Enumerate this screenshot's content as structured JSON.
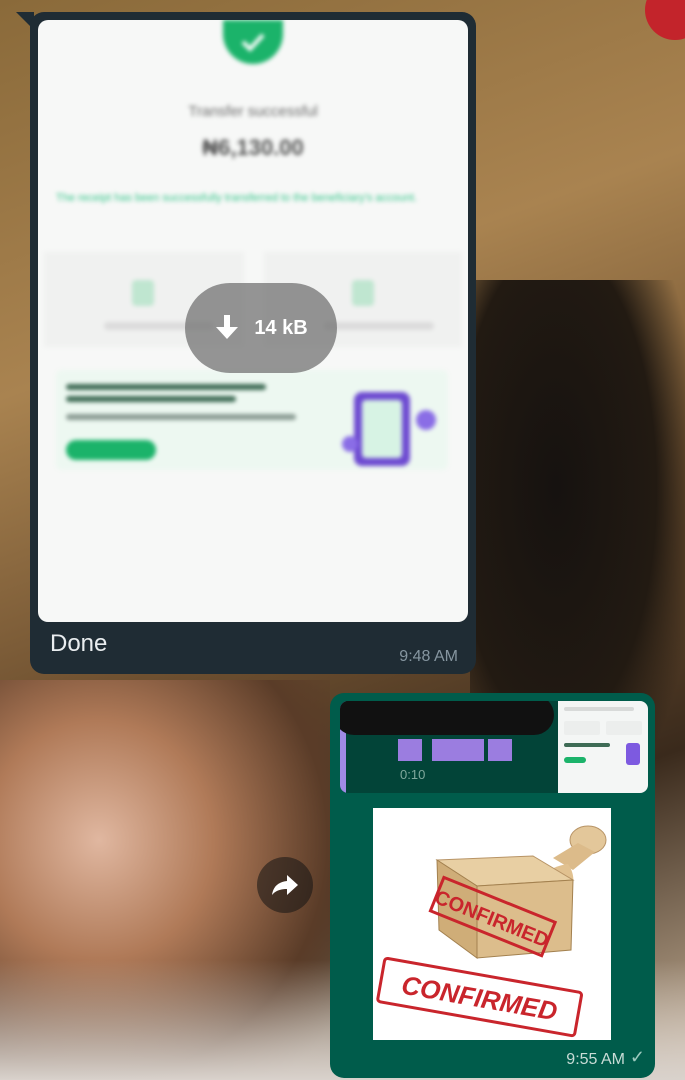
{
  "incoming": {
    "receipt": {
      "title": "Transfer successful",
      "amount": "₦6,130.00",
      "note": "The receipt has been successfully transferred to the beneficiary's account."
    },
    "download": {
      "size": "14 kB",
      "icon": "download-arrow-icon"
    },
    "caption": "Done",
    "time": "9:48 AM"
  },
  "forward": {
    "icon": "forward-arrow-icon"
  },
  "outgoing": {
    "reply_sub": "0:10",
    "stamp": {
      "top_text": "CONFIRMED",
      "bottom_text": "CONFIRMED"
    },
    "time": "9:55 AM",
    "status_icon": "single-check-icon"
  },
  "colors": {
    "incoming_bubble": "#1f2c34",
    "outgoing_bubble": "#005c4b",
    "accent_green": "#1bb36a",
    "stamp_red": "#c9252c"
  }
}
